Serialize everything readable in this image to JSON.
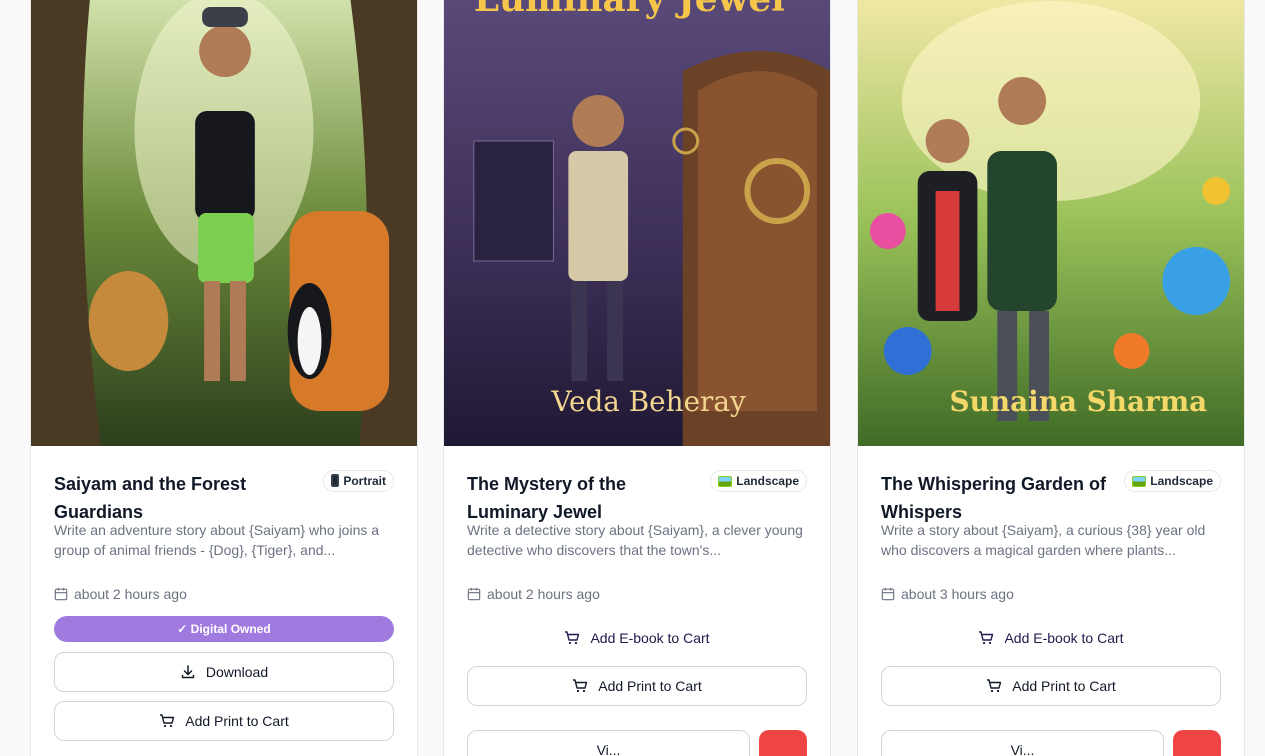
{
  "cards": [
    {
      "title": "Saiyam and the Forest Guardians",
      "orientation": "Portrait",
      "orientation_icon": "phone-icon",
      "description": "Write an adventure story about {Saiyam} who joins a group of animal friends - {Dog}, {Tiger}, and...",
      "time": "about 2 hours ago",
      "owned_label": "✓ Digital Owned",
      "download_label": "Download",
      "print_label": "Add Print to Cart"
    },
    {
      "title": "The Mystery of the Luminary Jewel",
      "orientation": "Landscape",
      "orientation_icon": "picture-icon",
      "description": "Write a detective story about {Saiyam}, a clever young detective who discovers that the town's...",
      "time": "about 2 hours ago",
      "ebook_label": "Add E-book to Cart",
      "print_label": "Add Print to Cart",
      "view_label": "Vi...",
      "cover_title_text": "Luminary Jewel",
      "cover_author_text": "Veda Beheray"
    },
    {
      "title": "The Whispering Garden of Whispers",
      "orientation": "Landscape",
      "orientation_icon": "picture-icon",
      "description": "Write a story about {Saiyam}, a curious {38} year old who discovers a magical garden where plants...",
      "time": "about 3 hours ago",
      "ebook_label": "Add E-book to Cart",
      "print_label": "Add Print to Cart",
      "view_label": "Vi...",
      "cover_author_text": "Sunaina Sharma"
    }
  ],
  "colors": {
    "owned_badge": "#a17ae0",
    "delete_button": "#ef4444",
    "ebook_text": "#1e1b4b"
  }
}
